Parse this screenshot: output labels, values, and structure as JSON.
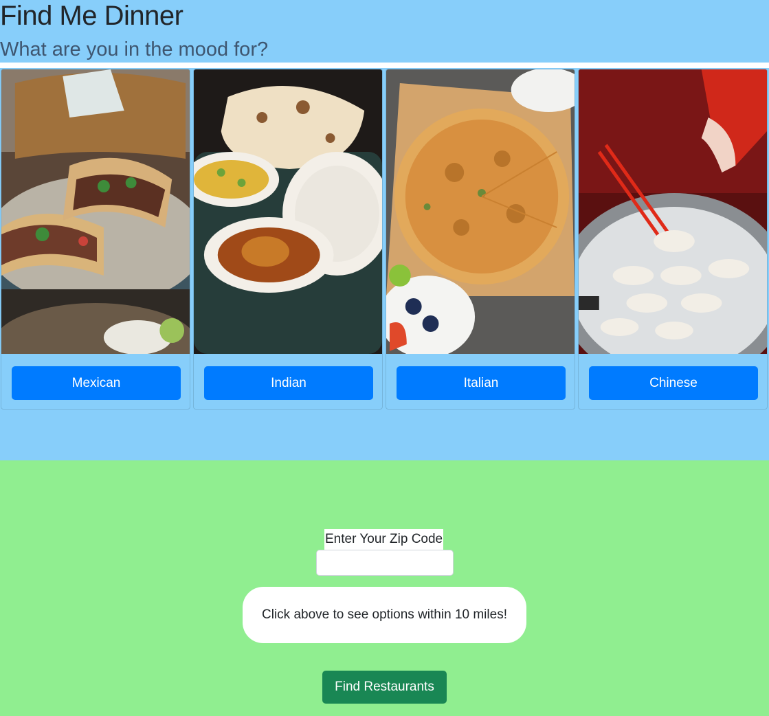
{
  "header": {
    "title": "Find Me Dinner",
    "subtitle": "What are you in the mood for?"
  },
  "cuisines": [
    {
      "label": "Mexican",
      "image": "tacos-photo"
    },
    {
      "label": "Indian",
      "image": "naan-curry-photo"
    },
    {
      "label": "Italian",
      "image": "pizza-photo"
    },
    {
      "label": "Chinese",
      "image": "dumplings-photo"
    }
  ],
  "zip": {
    "label": "Enter Your Zip Code",
    "value": "",
    "placeholder": ""
  },
  "info": {
    "text": "Click above to see options within 10 miles!"
  },
  "actions": {
    "find_label": "Find Restaurants"
  },
  "colors": {
    "header_bg": "#87cefa",
    "page_bg": "#90ee90",
    "cuisine_button": "#007bff",
    "find_button": "#198754"
  }
}
